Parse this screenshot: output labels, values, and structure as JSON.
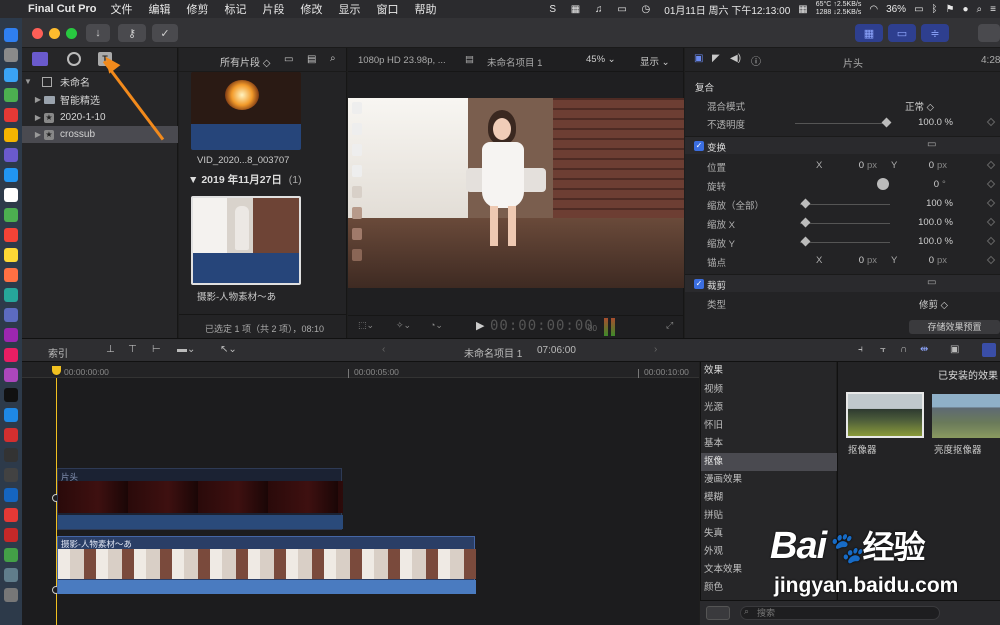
{
  "menubar": {
    "app": "Final Cut Pro",
    "items": [
      "文件",
      "编辑",
      "修剪",
      "标记",
      "片段",
      "修改",
      "显示",
      "窗口",
      "帮助"
    ],
    "cpu": "65°C",
    "fan": "1288",
    "net_up": "↑2.5KB/s",
    "net_down": "↓2.5KB/s",
    "battery": "36%",
    "clock": "01月11日 周六 下午12:13:00"
  },
  "libraries": {
    "root": "未命名",
    "items": [
      {
        "label": "智能精选",
        "icon": "folder-icon"
      },
      {
        "label": "2020-1-10",
        "icon": "event-star-icon"
      },
      {
        "label": "crossub",
        "icon": "event-star-icon",
        "selected": true
      }
    ]
  },
  "browser": {
    "filter": "所有片段 ◇",
    "clip1_name": "VID_2020...8_003707",
    "date_group": "2019 年11月27日",
    "date_count": "(1)",
    "clip2_name": "摄影-人物素材～あ",
    "status": "已选定 1 项（共 2 项），08:10"
  },
  "viewer": {
    "format": "1080p HD 23.98p, ...",
    "project": "未命名项目 1",
    "zoom": "45%",
    "display": "显示",
    "timecode": "00:00:00:00",
    "timecode_sub": "00"
  },
  "inspector": {
    "title": "片头",
    "timecode_right": "4:28",
    "composite": "复合",
    "blend_mode_label": "混合模式",
    "blend_mode_value": "正常 ◇",
    "opacity_label": "不透明度",
    "opacity_value": "100.0 %",
    "opacity_fraction": 1.0,
    "transform": "变换",
    "position_label": "位置",
    "x": "X",
    "y": "Y",
    "px": "px",
    "pos_x": "0",
    "pos_y": "0",
    "rotation_label": "旋转",
    "rotation_value": "0",
    "deg": "°",
    "scale_all_label": "缩放（全部）",
    "scale_all_value": "100 %",
    "scale_x_label": "缩放 X",
    "scale_x_value": "100.0 %",
    "scale_y_label": "缩放 Y",
    "scale_y_value": "100.0 %",
    "anchor_label": "锚点",
    "anchor_x": "0",
    "anchor_y": "0",
    "crop": "裁剪",
    "type_label": "类型",
    "type_value": "修剪 ◇",
    "save_preset": "存储效果预置"
  },
  "timeline": {
    "index": "索引",
    "project": "未命名项目 1",
    "duration": "07:06:00",
    "ruler": [
      "00:00:00:00",
      "00:00:05:00",
      "00:00:10:00"
    ],
    "title_clip": "片头",
    "video_clip": "摄影-人物素材～あ"
  },
  "effects": {
    "header": "效果",
    "installed": "已安装的效果",
    "categories": [
      "视频",
      "光源",
      "怀旧",
      "基本",
      "抠像",
      "漫画效果",
      "模糊",
      "拼贴",
      "失真",
      "外观",
      "文本效果",
      "颜色"
    ],
    "selected": "抠像",
    "thumbs": [
      "抠像器",
      "亮度抠像器"
    ],
    "search_placeholder": "搜索"
  },
  "watermark": {
    "brand": "Bai",
    "brand_cn": "经验",
    "url": "jingyan.baidu.com"
  },
  "colors": {
    "accent": "#3b6ee0",
    "playhead": "#f0c020",
    "annotation": "#f28a1c"
  }
}
